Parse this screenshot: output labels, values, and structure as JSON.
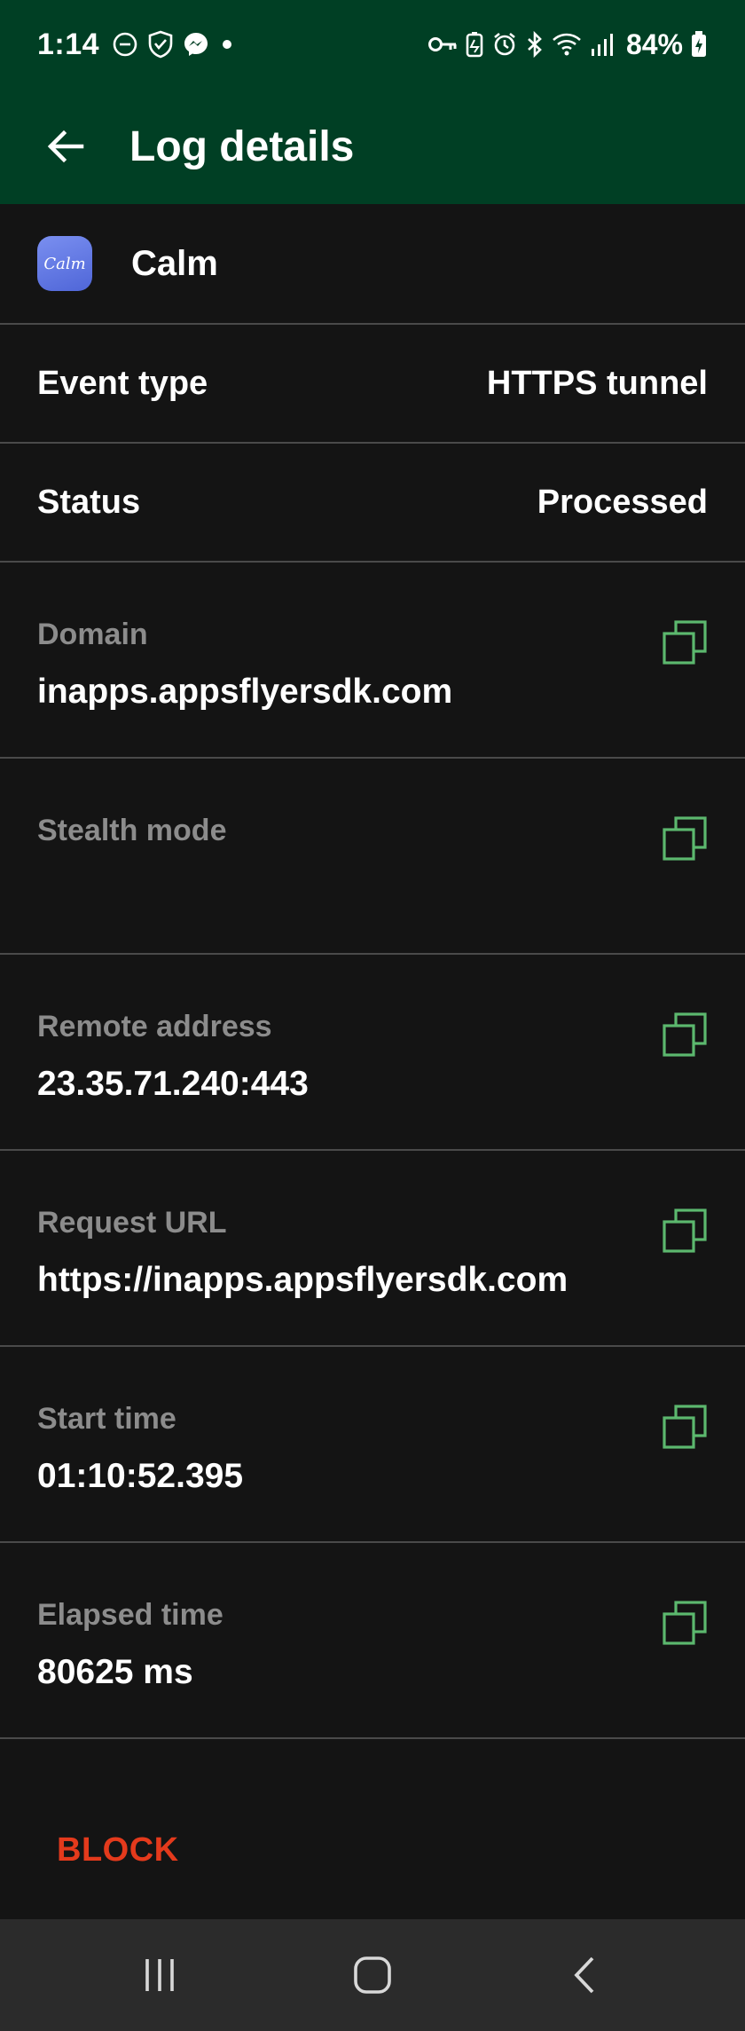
{
  "status_bar": {
    "time": "1:14",
    "battery": "84%",
    "left_icons": [
      "do-not-disturb-icon",
      "shield-check-icon",
      "messenger-icon",
      "dot-icon"
    ],
    "right_icons": [
      "vpn-key-icon",
      "battery-saver-icon",
      "alarm-icon",
      "bluetooth-icon",
      "wifi-icon",
      "signal-icon",
      "battery-charging-icon"
    ]
  },
  "app_bar": {
    "title": "Log details",
    "back_icon": "arrow-left-icon",
    "background": "#003f24"
  },
  "app": {
    "name": "Calm",
    "icon_text": "Calm"
  },
  "summary": [
    {
      "label": "Event type",
      "value": "HTTPS tunnel"
    },
    {
      "label": "Status",
      "value": "Processed"
    }
  ],
  "details": [
    {
      "label": "Domain",
      "value": "inapps.appsflyersdk.com"
    },
    {
      "label": "Stealth mode",
      "value": ""
    },
    {
      "label": "Remote address",
      "value": "23.35.71.240:443"
    },
    {
      "label": "Request URL",
      "value": "https://inapps.appsflyersdk.com"
    },
    {
      "label": "Start time",
      "value": "01:10:52.395"
    },
    {
      "label": "Elapsed time",
      "value": "80625 ms"
    }
  ],
  "actions": {
    "block_label": "BLOCK",
    "block_color": "#e43a1c"
  },
  "colors": {
    "accent_green": "#5cb86e",
    "background": "#141414",
    "divider": "#4a4a4a",
    "label_gray": "#8c8c8c"
  },
  "nav_bar": {
    "buttons": [
      "recent-apps-icon",
      "home-icon",
      "back-icon"
    ]
  }
}
